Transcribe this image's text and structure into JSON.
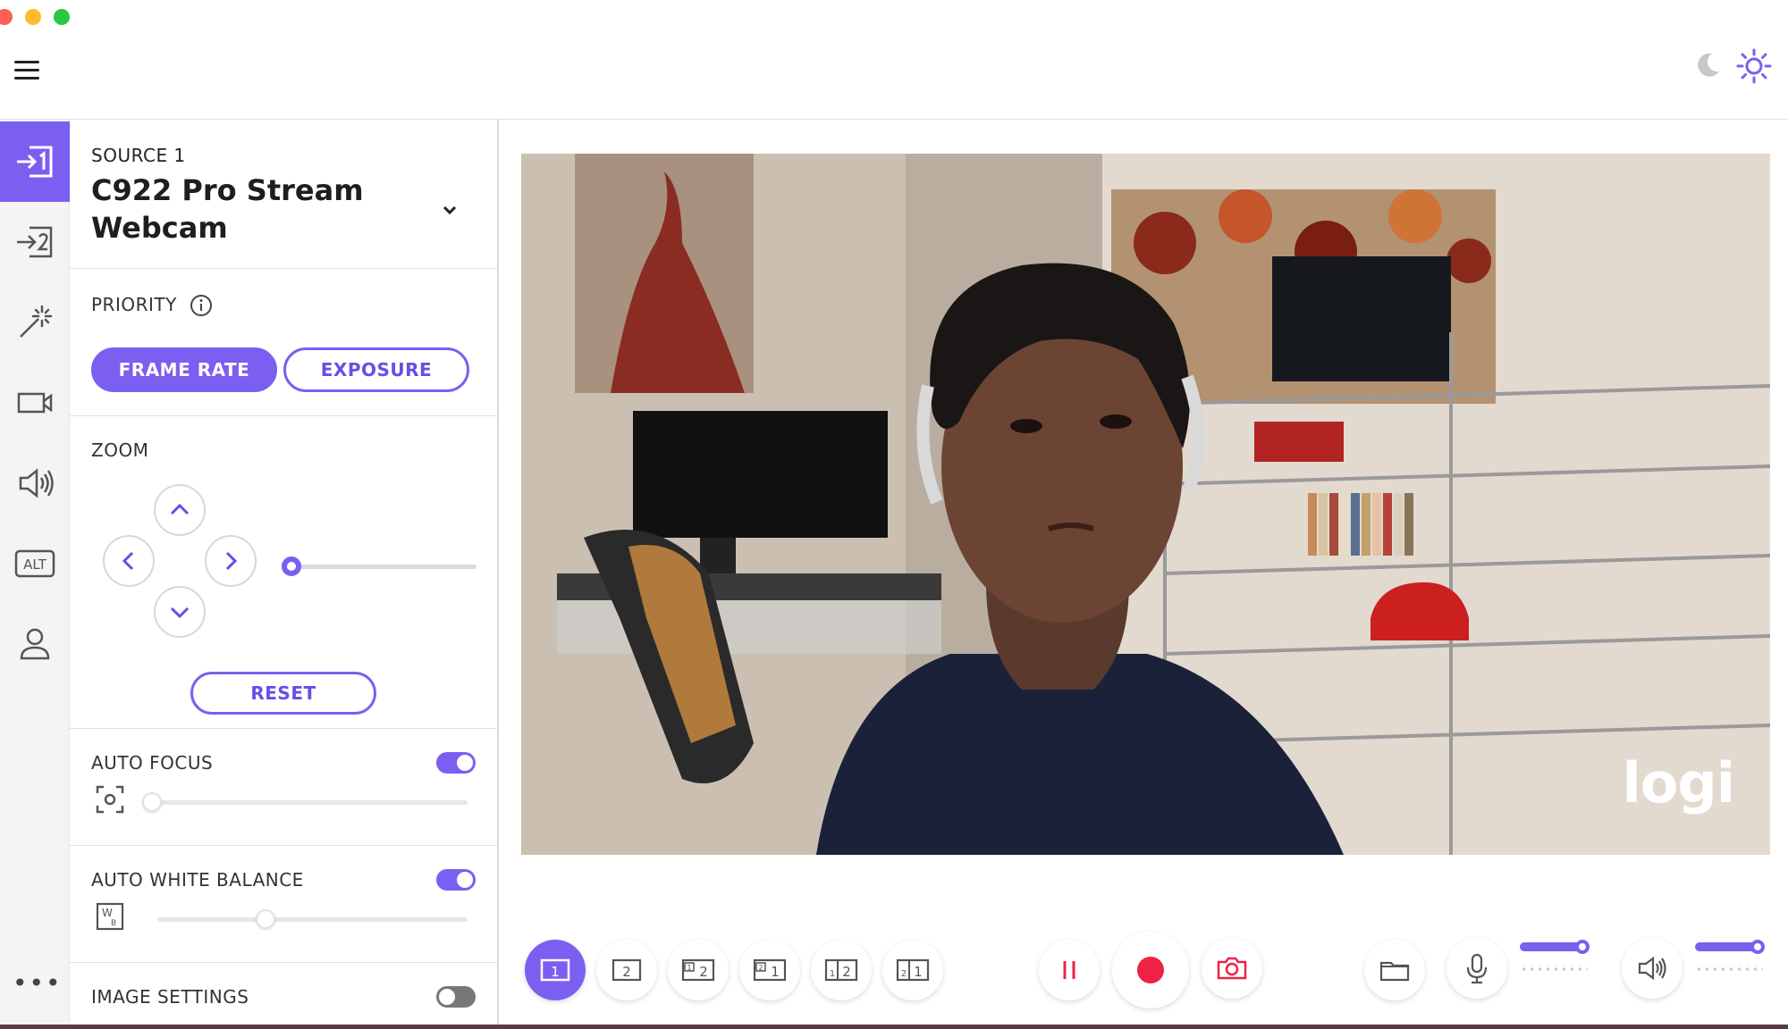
{
  "header": {
    "menu_icon": "hamburger-icon",
    "theme_dark_icon": "moon-icon",
    "theme_light_icon": "sun-icon"
  },
  "rail": {
    "items": [
      {
        "name": "source-1",
        "icon": "input-1-icon",
        "active": true
      },
      {
        "name": "source-2",
        "icon": "input-2-icon",
        "active": false
      },
      {
        "name": "effects",
        "icon": "magic-wand-icon",
        "active": false
      },
      {
        "name": "camera",
        "icon": "video-camera-icon",
        "active": false
      },
      {
        "name": "audio",
        "icon": "speaker-icon",
        "active": false
      },
      {
        "name": "alt",
        "icon": "alt-icon",
        "label": "ALT",
        "active": false
      },
      {
        "name": "account",
        "icon": "person-icon",
        "active": false
      }
    ],
    "more_label": "•••"
  },
  "source": {
    "label": "SOURCE 1",
    "device_name": "C922 Pro Stream Webcam"
  },
  "priority": {
    "title": "PRIORITY",
    "options": [
      "FRAME RATE",
      "EXPOSURE"
    ],
    "selected": "FRAME RATE"
  },
  "zoom": {
    "title": "ZOOM",
    "level": 0.0,
    "reset_label": "RESET"
  },
  "auto_focus": {
    "title": "AUTO FOCUS",
    "enabled": true,
    "level": 0.0
  },
  "auto_white_balance": {
    "title": "AUTO WHITE BALANCE",
    "enabled": true,
    "level": 0.35
  },
  "image_settings": {
    "title": "IMAGE SETTINGS",
    "enabled": false
  },
  "preview": {
    "watermark": "logi"
  },
  "layouts": [
    {
      "name": "layout-1",
      "label": "1",
      "active": true
    },
    {
      "name": "layout-2",
      "label": "2",
      "active": false
    },
    {
      "name": "layout-1-2-pip",
      "label": "1 2",
      "active": false
    },
    {
      "name": "layout-2-1-pip",
      "label": "2 1",
      "active": false
    },
    {
      "name": "layout-1-2-split",
      "label": "1 2",
      "active": false
    },
    {
      "name": "layout-2-1-split",
      "label": "2 1",
      "active": false
    }
  ],
  "controls": {
    "mic_volume": 0.95,
    "speaker_volume": 0.95
  },
  "colors": {
    "accent": "#7b5ff0",
    "record": "#ee2244"
  }
}
